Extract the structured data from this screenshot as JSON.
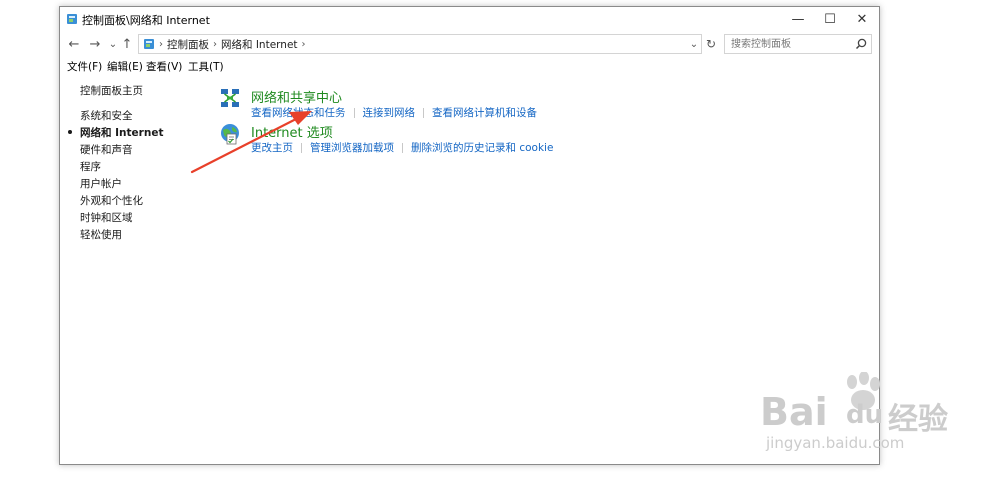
{
  "window": {
    "title": "控制面板\\网络和 Internet",
    "controls": {
      "minimize": "—",
      "maximize": "☐",
      "close": "✕"
    }
  },
  "nav": {
    "back": "←",
    "forward": "→",
    "recent": "⌄",
    "up": "↑",
    "refresh": "↻"
  },
  "address": {
    "crumbs": [
      "控制面板",
      "网络和 Internet"
    ],
    "separator": "›"
  },
  "search": {
    "placeholder": "搜索控制面板",
    "value": ""
  },
  "menu": [
    "文件(F)",
    "编辑(E)",
    "查看(V)",
    "工具(T)"
  ],
  "sidebar": {
    "home": "控制面板主页",
    "items": [
      {
        "label": "系统和安全",
        "active": false
      },
      {
        "label": "网络和 Internet",
        "active": true
      },
      {
        "label": "硬件和声音",
        "active": false
      },
      {
        "label": "程序",
        "active": false
      },
      {
        "label": "用户帐户",
        "active": false
      },
      {
        "label": "外观和个性化",
        "active": false
      },
      {
        "label": "时钟和区域",
        "active": false
      },
      {
        "label": "轻松使用",
        "active": false
      }
    ]
  },
  "categories": [
    {
      "title": "网络和共享中心",
      "icon": "network-sharing-icon",
      "links": [
        "查看网络状态和任务",
        "连接到网络",
        "查看网络计算机和设备"
      ]
    },
    {
      "title": "Internet 选项",
      "icon": "internet-options-icon",
      "links": [
        "更改主页",
        "管理浏览器加载项",
        "删除浏览的历史记录和 cookie"
      ]
    }
  ],
  "watermark": {
    "brand": "Bai",
    "brand2": "du",
    "cn": "经验",
    "url": "jingyan.baidu.com"
  },
  "colors": {
    "category_title": "#1f8a1f",
    "link": "#1466c4",
    "annotation_arrow": "#e8402a"
  }
}
